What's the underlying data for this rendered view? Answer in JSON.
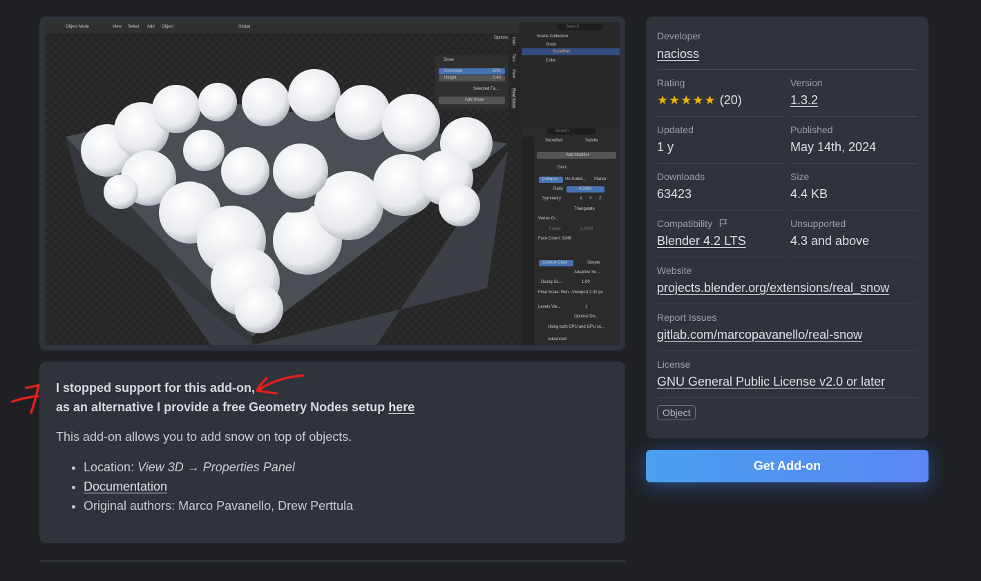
{
  "screenshot": {
    "header": {
      "mode": "Object Mode",
      "menus": [
        "View",
        "Select",
        "Add",
        "Object"
      ],
      "transform": "Global",
      "options": "Options"
    },
    "npanel": {
      "title": "Snow",
      "coverage_label": "Coverage",
      "coverage_value": "50%",
      "height_label": "Height",
      "height_value": "0.40",
      "selected_faces": "Selected Fa...",
      "add_snow": "Add Snow",
      "tabs": [
        "Item",
        "Tool",
        "View",
        "Real Snow"
      ]
    },
    "outliner": {
      "search": "Search",
      "scene_collection": "Scene Collection",
      "items": [
        "Snow",
        "SnowBall",
        "Cube"
      ]
    },
    "properties": {
      "search": "Search",
      "breadcrumb_object": "SnowBall",
      "breadcrumb_modifier": "Subdiv",
      "add_modifier": "Add Modifier",
      "decimate_name": "Deci...",
      "decimate_tabs": [
        "Collapse",
        "Un-Subdi...",
        "Planar"
      ],
      "ratio_label": "Ratio",
      "ratio_value": "0.5000",
      "symmetry_label": "Symmetry",
      "axes": [
        "X",
        "Y",
        "Z"
      ],
      "triangulate": "Triangulate",
      "vertex_group": "Vertex Gr...",
      "factor_label": "Factor",
      "factor_value": "1.0000",
      "face_count": "Face Count: 3246",
      "subdiv_tabs": [
        "Catmull-Clark",
        "Simple"
      ],
      "adaptive": "Adaptive Su...",
      "dicing_label": "Dicing Sc...",
      "dicing_value": "1.00",
      "final_scale": "Final Scale: Ren...Viewport 2.00 px",
      "levels_label": "Levels Vie...",
      "levels_value": "1",
      "optimal": "Optimal Dis...",
      "info": "Using both CPU and GPU su...",
      "advanced": "Advanced"
    }
  },
  "description": {
    "notice_line1": "I stopped support for this add-on,",
    "notice_line2": "as an alternative I provide a free Geometry Nodes setup ",
    "notice_link": "here",
    "intro": "This add-on allows you to add snow on top of objects.",
    "location_label": "Location: ",
    "location_value": "View 3D → Properties Panel",
    "documentation": "Documentation",
    "authors": "Original authors: Marco Pavanello, Drew Perttula",
    "annotation_color": "#e0201b"
  },
  "sidebar": {
    "developer_label": "Developer",
    "developer": "nacioss",
    "rating_label": "Rating",
    "rating_stars": 5,
    "rating_stars_text": "★★★★★",
    "rating_count": "(20)",
    "version_label": "Version",
    "version": "1.3.2",
    "updated_label": "Updated",
    "updated": "1 y",
    "published_label": "Published",
    "published": "May 14th, 2024",
    "downloads_label": "Downloads",
    "downloads": "63423",
    "size_label": "Size",
    "size": "4.4 KB",
    "compat_label": "Compatibility",
    "compat": "Blender 4.2 LTS",
    "unsupported_label": "Unsupported",
    "unsupported": "4.3 and above",
    "website_label": "Website",
    "website": "projects.blender.org/extensions/real_snow",
    "issues_label": "Report Issues",
    "issues": "gitlab.com/marcopavanello/real-snow",
    "license_label": "License",
    "license": "GNU General Public License v2.0 or later",
    "tag": "Object"
  },
  "get_button": "Get Add-on",
  "colors": {
    "page": "#1e2024",
    "card": "#2f333b",
    "star": "#eab308",
    "button_start": "#4aa0ee",
    "button_end": "#5a86f5"
  }
}
